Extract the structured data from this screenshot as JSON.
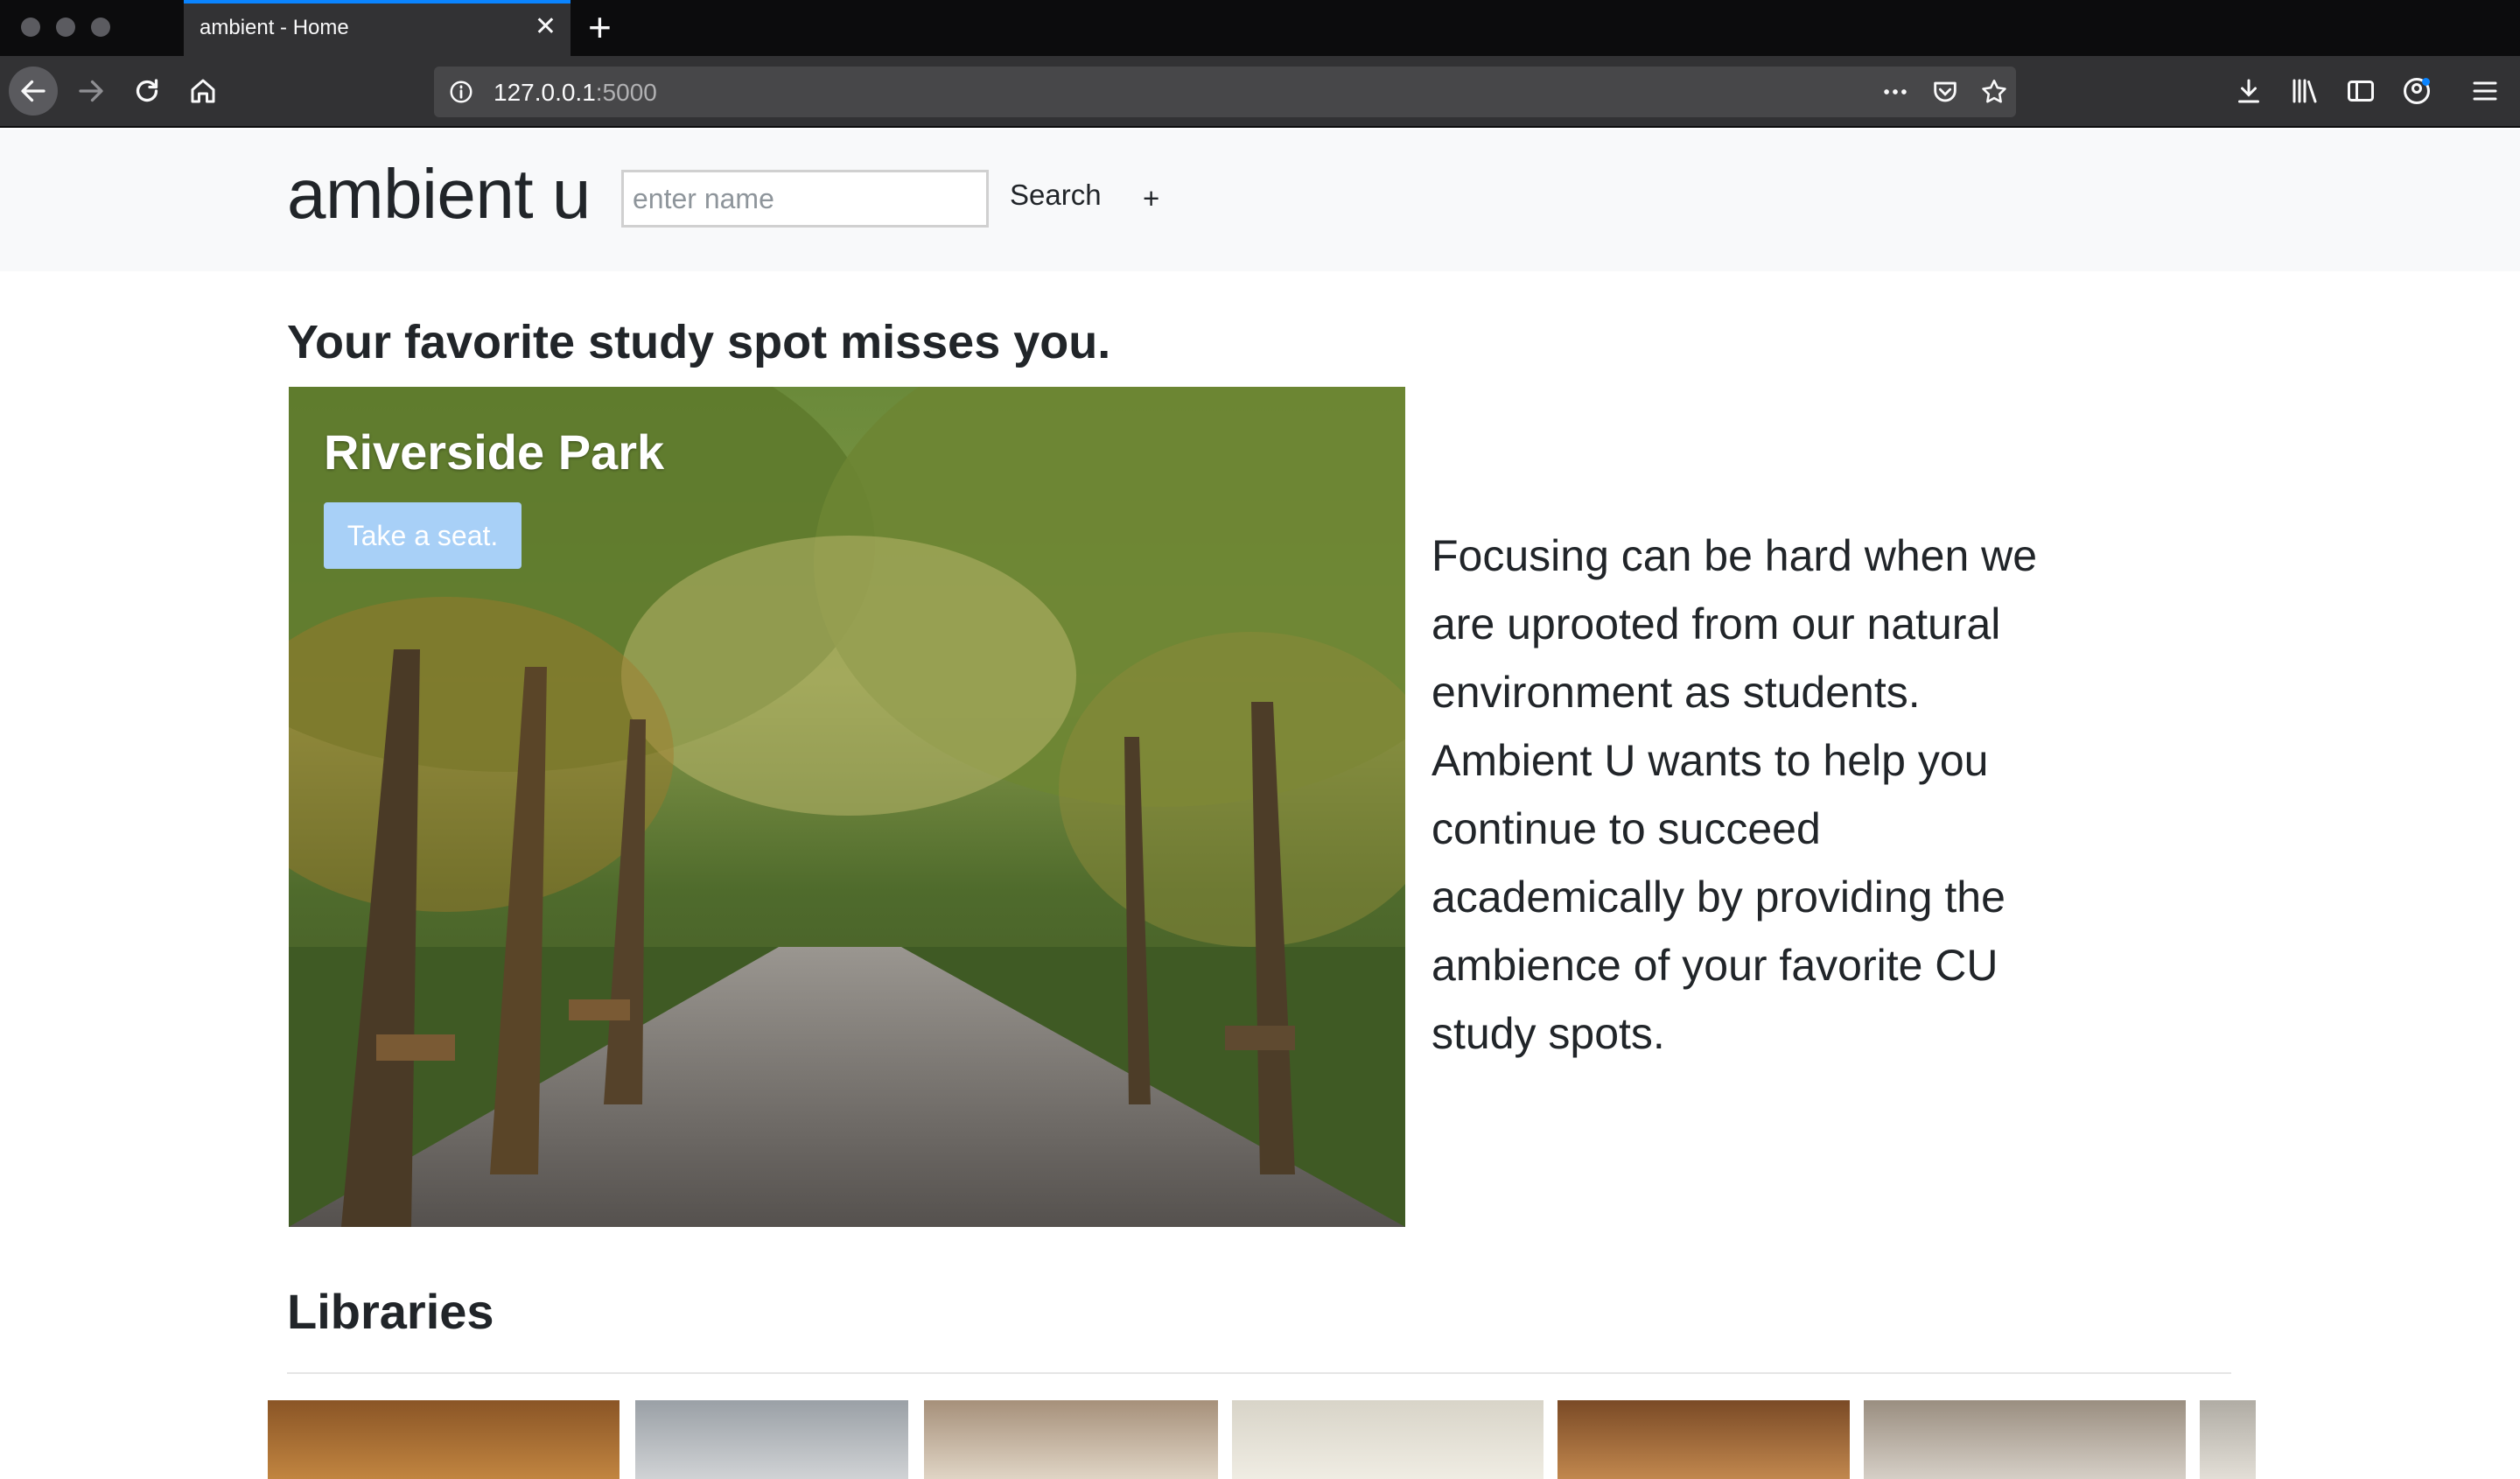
{
  "browser": {
    "tab_title": "ambient - Home",
    "tab_close": "✕",
    "new_tab": "+",
    "url_host": "127.0.0.1",
    "url_port": ":5000"
  },
  "header": {
    "brand": "ambient u",
    "search_placeholder": "enter name",
    "search_label": "Search",
    "add_label": "+"
  },
  "hero": {
    "tagline": "Your favorite study spot misses you.",
    "spot_name": "Riverside Park",
    "button_label": "Take a seat.",
    "description": "Focusing can be hard when we are uprooted from our natural environment as students. Ambient U wants to help you continue to succeed academically by providing the ambience of your favorite CU study spots."
  },
  "libraries": {
    "title": "Libraries"
  },
  "colors": {
    "accent": "#0a84ff",
    "hero_button": "#a8d0f7",
    "header_bg": "#f8f9fa"
  }
}
